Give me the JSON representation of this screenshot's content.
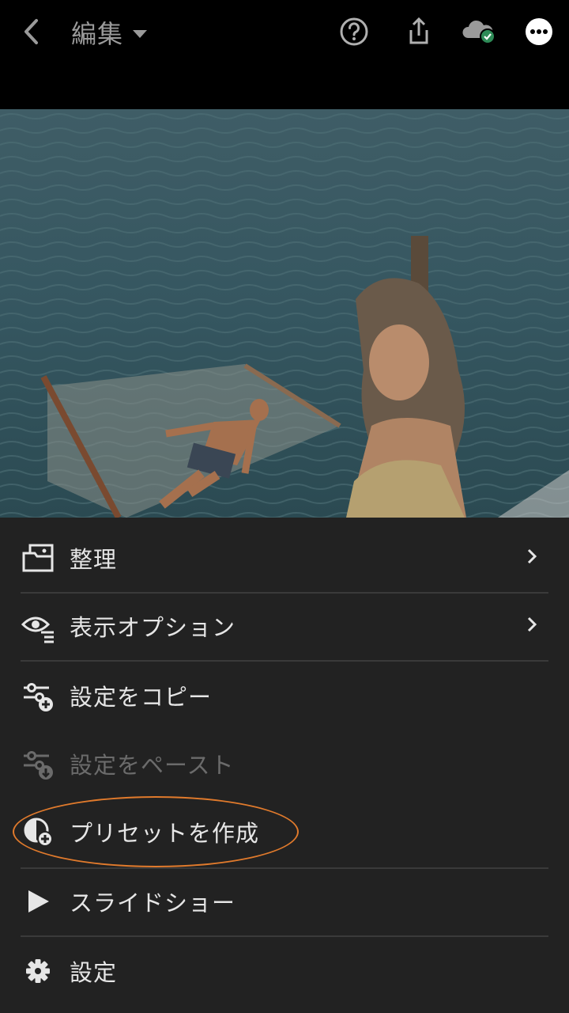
{
  "header": {
    "title": "編集",
    "icons": [
      "back-arrow-icon",
      "help-icon",
      "share-icon",
      "cloud-synced-icon",
      "more-icon"
    ]
  },
  "menu": {
    "items": [
      {
        "label": "整理",
        "icon": "organize-icon",
        "has_chevron": true,
        "enabled": true
      },
      {
        "label": "表示オプション",
        "icon": "view-options-icon",
        "has_chevron": true,
        "enabled": true
      },
      {
        "label": "設定をコピー",
        "icon": "copy-settings-icon",
        "has_chevron": false,
        "enabled": true
      },
      {
        "label": "設定をペースト",
        "icon": "paste-settings-icon",
        "has_chevron": false,
        "enabled": false
      },
      {
        "label": "プリセットを作成",
        "icon": "create-preset-icon",
        "has_chevron": false,
        "enabled": true,
        "highlighted": true
      },
      {
        "label": "スライドショー",
        "icon": "play-icon",
        "has_chevron": false,
        "enabled": true
      },
      {
        "label": "設定",
        "icon": "gear-icon",
        "has_chevron": false,
        "enabled": true
      }
    ]
  },
  "colors": {
    "background": "#000000",
    "menu_background": "#222222",
    "highlight_ring": "#e07a2c",
    "sync_badge": "#2e8b57"
  }
}
